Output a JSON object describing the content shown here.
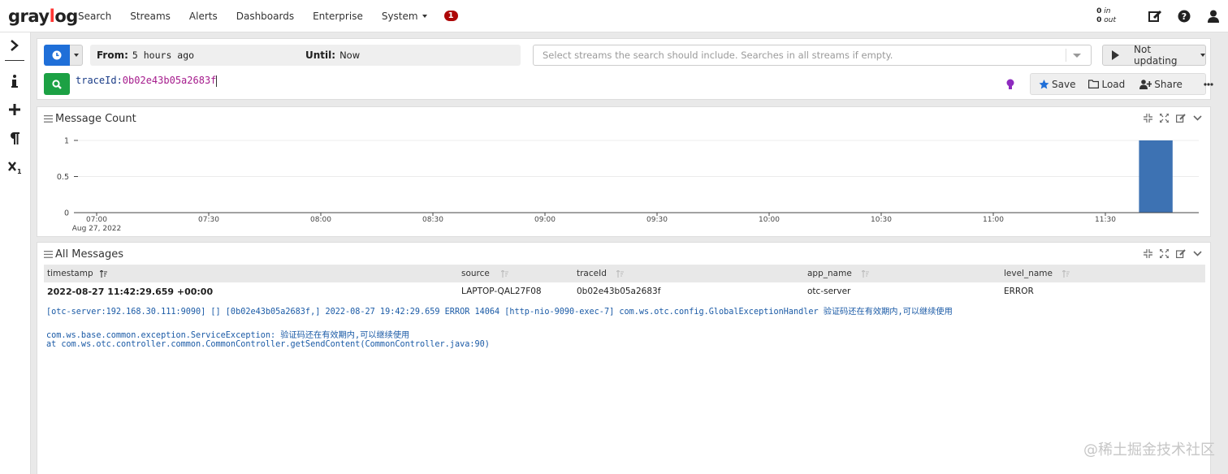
{
  "app": {
    "logo": "graylog"
  },
  "topnav": {
    "items": [
      {
        "label": "Search"
      },
      {
        "label": "Streams"
      },
      {
        "label": "Alerts"
      },
      {
        "label": "Dashboards"
      },
      {
        "label": "Enterprise"
      },
      {
        "label": "System"
      }
    ],
    "notification_count": "1",
    "throughput": {
      "in_value": "0",
      "in_label": "in",
      "out_value": "0",
      "out_label": "out"
    },
    "icons": [
      "edit-icon",
      "help-icon",
      "user-icon"
    ]
  },
  "sidebar": {
    "icons": [
      "chevron-right-icon",
      "info-icon",
      "plus-icon",
      "paragraph-icon",
      "subscript-icon"
    ]
  },
  "search": {
    "from_label": "From:",
    "from_value": "5 hours ago",
    "until_label": "Until:",
    "until_value": "Now",
    "streams_placeholder": "Select streams the search should include. Searches in all streams if empty.",
    "refresh_label": "Not updating",
    "query_key": "traceId:",
    "query_value": "0b02e43b05a2683f",
    "actions": {
      "save": "Save",
      "load": "Load",
      "share": "Share"
    }
  },
  "message_count": {
    "title": "Message Count"
  },
  "chart_data": {
    "type": "bar",
    "title": "",
    "xlabel": "",
    "ylabel": "",
    "x_ticks": [
      "07:00",
      "07:30",
      "08:00",
      "08:30",
      "09:00",
      "09:30",
      "10:00",
      "10:30",
      "11:00",
      "11:30"
    ],
    "x_tick_sublabel": "Aug 27, 2022",
    "y_ticks": [
      "0",
      "0.5",
      "1"
    ],
    "ylim": [
      0,
      1
    ],
    "xlim": [
      "06:55",
      "11:55"
    ],
    "bars": [
      {
        "start": "11:39",
        "end": "11:48",
        "value": 1
      }
    ],
    "bar_color": "#3d72b3",
    "grid": true
  },
  "all_messages": {
    "title": "All Messages",
    "columns": [
      "timestamp",
      "source",
      "traceId",
      "app_name",
      "level_name"
    ],
    "rows": [
      {
        "timestamp": "2022-08-27 11:42:29.659 +00:00",
        "source": "LAPTOP-QAL27F08",
        "traceId": "0b02e43b05a2683f",
        "app_name": "otc-server",
        "level_name": "ERROR",
        "message_lines": [
          "[otc-server:192.168.30.111:9090] [] [0b02e43b05a2683f,] 2022-08-27 19:42:29.659 ERROR 14064 [http-nio-9090-exec-7] com.ws.otc.config.GlobalExceptionHandler 验证码还在有效期内,可以继续使用",
          "",
          "com.ws.base.common.exception.ServiceException: 验证码还在有效期内,可以继续使用",
          "at com.ws.otc.controller.common.CommonController.getSendContent(CommonController.java:90)"
        ]
      }
    ]
  },
  "watermark": "@稀土掘金技术社区"
}
